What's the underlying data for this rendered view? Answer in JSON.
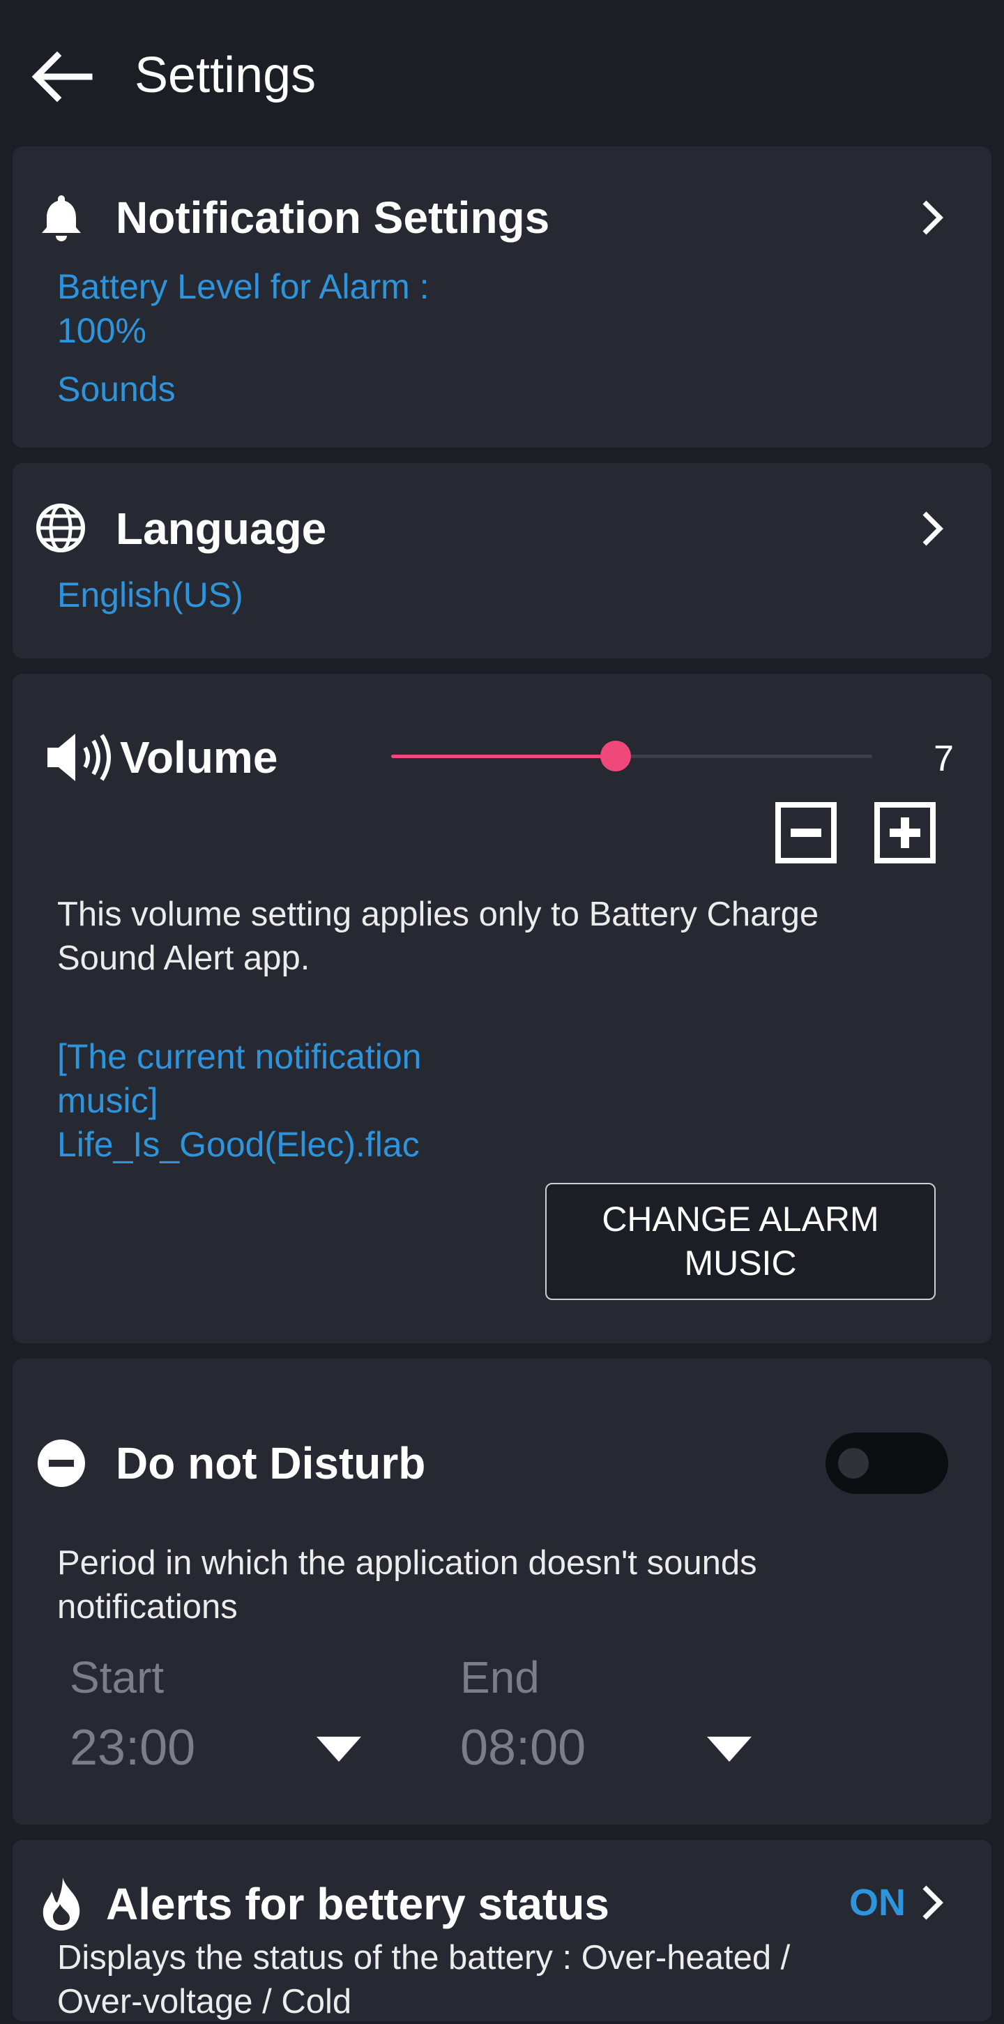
{
  "header": {
    "title": "Settings",
    "back_icon": "arrow-left-icon"
  },
  "notification_settings": {
    "title": "Notification Settings",
    "icon": "bell-icon",
    "battery_level_line1": "Battery Level for Alarm :",
    "battery_level_line2": "100%",
    "sounds": "Sounds"
  },
  "language": {
    "title": "Language",
    "icon": "globe-icon",
    "value": "English(US)"
  },
  "volume": {
    "title": "Volume",
    "icon": "speaker-icon",
    "level": 7,
    "slider_fraction": 0.466,
    "value": "7",
    "description_line1": "This volume setting applies only to Battery Charge",
    "description_line2": "Sound Alert app.",
    "current_music_line1": "[The current notification",
    "current_music_line2": "music]",
    "current_music_file": "Life_Is_Good(Elec).flac",
    "change_button": "CHANGE ALARM MUSIC",
    "accent_color": "#f0487b"
  },
  "do_not_disturb": {
    "title": "Do not Disturb",
    "icon": "minus-circle-icon",
    "enabled": false,
    "description_line1": "Period in which the application doesn't sounds",
    "description_line2": "notifications",
    "start_label": "Start",
    "start_value": "23:00",
    "end_label": "End",
    "end_value": "08:00"
  },
  "battery_alerts": {
    "title": "Alerts for bettery status",
    "icon": "flame-icon",
    "status": "ON",
    "description_line1": "Displays the status of the battery : Over-heated /",
    "description_line2": "Over-voltage / Cold"
  },
  "colors": {
    "background": "#1b1e25",
    "card": "#262931",
    "link_blue": "#2e94dc"
  }
}
